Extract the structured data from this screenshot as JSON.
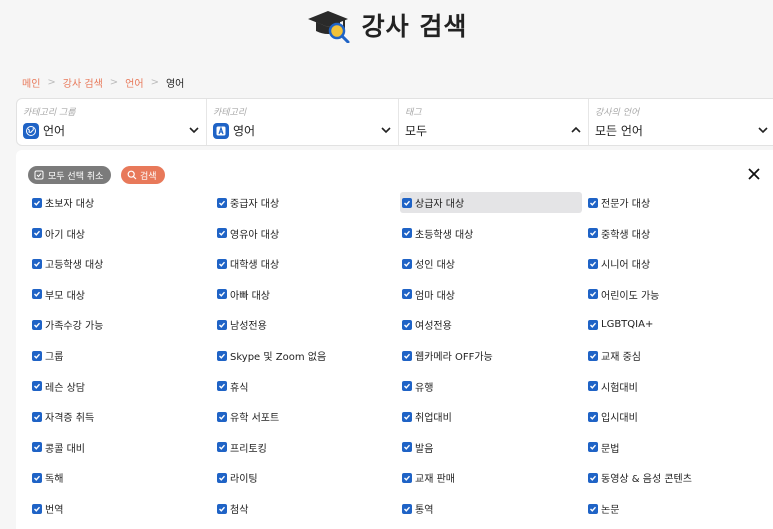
{
  "header": {
    "title": "강사 검색",
    "icon": "graduation-cap-search-icon"
  },
  "breadcrumb": [
    "메인",
    "강사 검색",
    "언어",
    "영어"
  ],
  "filters": [
    {
      "label": "카테고리 그룹",
      "value": "언어",
      "icon": "globe-icon",
      "chevron": "down"
    },
    {
      "label": "카테고리",
      "value": "영어",
      "icon": "language-a-icon",
      "chevron": "down"
    },
    {
      "label": "태그",
      "value": "모두",
      "icon": "",
      "chevron": "up"
    },
    {
      "label": "강사의 언어",
      "value": "모든 언어",
      "icon": "",
      "chevron": "down"
    }
  ],
  "panel": {
    "deselect_label": "모두 선택 취소",
    "search_label": "검색",
    "close_icon": "close-icon"
  },
  "tags": [
    [
      "초보자 대상",
      "중급자 대상",
      "상급자 대상",
      "전문가 대상"
    ],
    [
      "아기 대상",
      "영유아 대상",
      "초등학생 대상",
      "중학생 대상"
    ],
    [
      "고등학생 대상",
      "대학생 대상",
      "성인 대상",
      "시니어 대상"
    ],
    [
      "부모 대상",
      "아빠 대상",
      "엄마 대상",
      "어린이도 가능"
    ],
    [
      "가족수강 가능",
      "남성전용",
      "여성전용",
      "LGBTQIA+"
    ],
    [
      "그룹",
      "Skype 및 Zoom 없음",
      "웹카메라 OFF가능",
      "교재 중심"
    ],
    [
      "레슨 상담",
      "휴식",
      "유행",
      "시험대비"
    ],
    [
      "자격증 취득",
      "유학 서포트",
      "취업대비",
      "입시대비"
    ],
    [
      "콩콜 대비",
      "프리토킹",
      "발음",
      "문법"
    ],
    [
      "독해",
      "라이팅",
      "교재 판매",
      "동영상 & 음성 콘텐츠"
    ],
    [
      "번역",
      "첨삭",
      "통역",
      "논문"
    ]
  ],
  "highlighted_tag": "상급자 대상",
  "colors": {
    "accent": "#e8795a",
    "checkbox": "#1f63c6",
    "deselect": "#7b7b7b",
    "highlight": "#e4e4e6"
  }
}
